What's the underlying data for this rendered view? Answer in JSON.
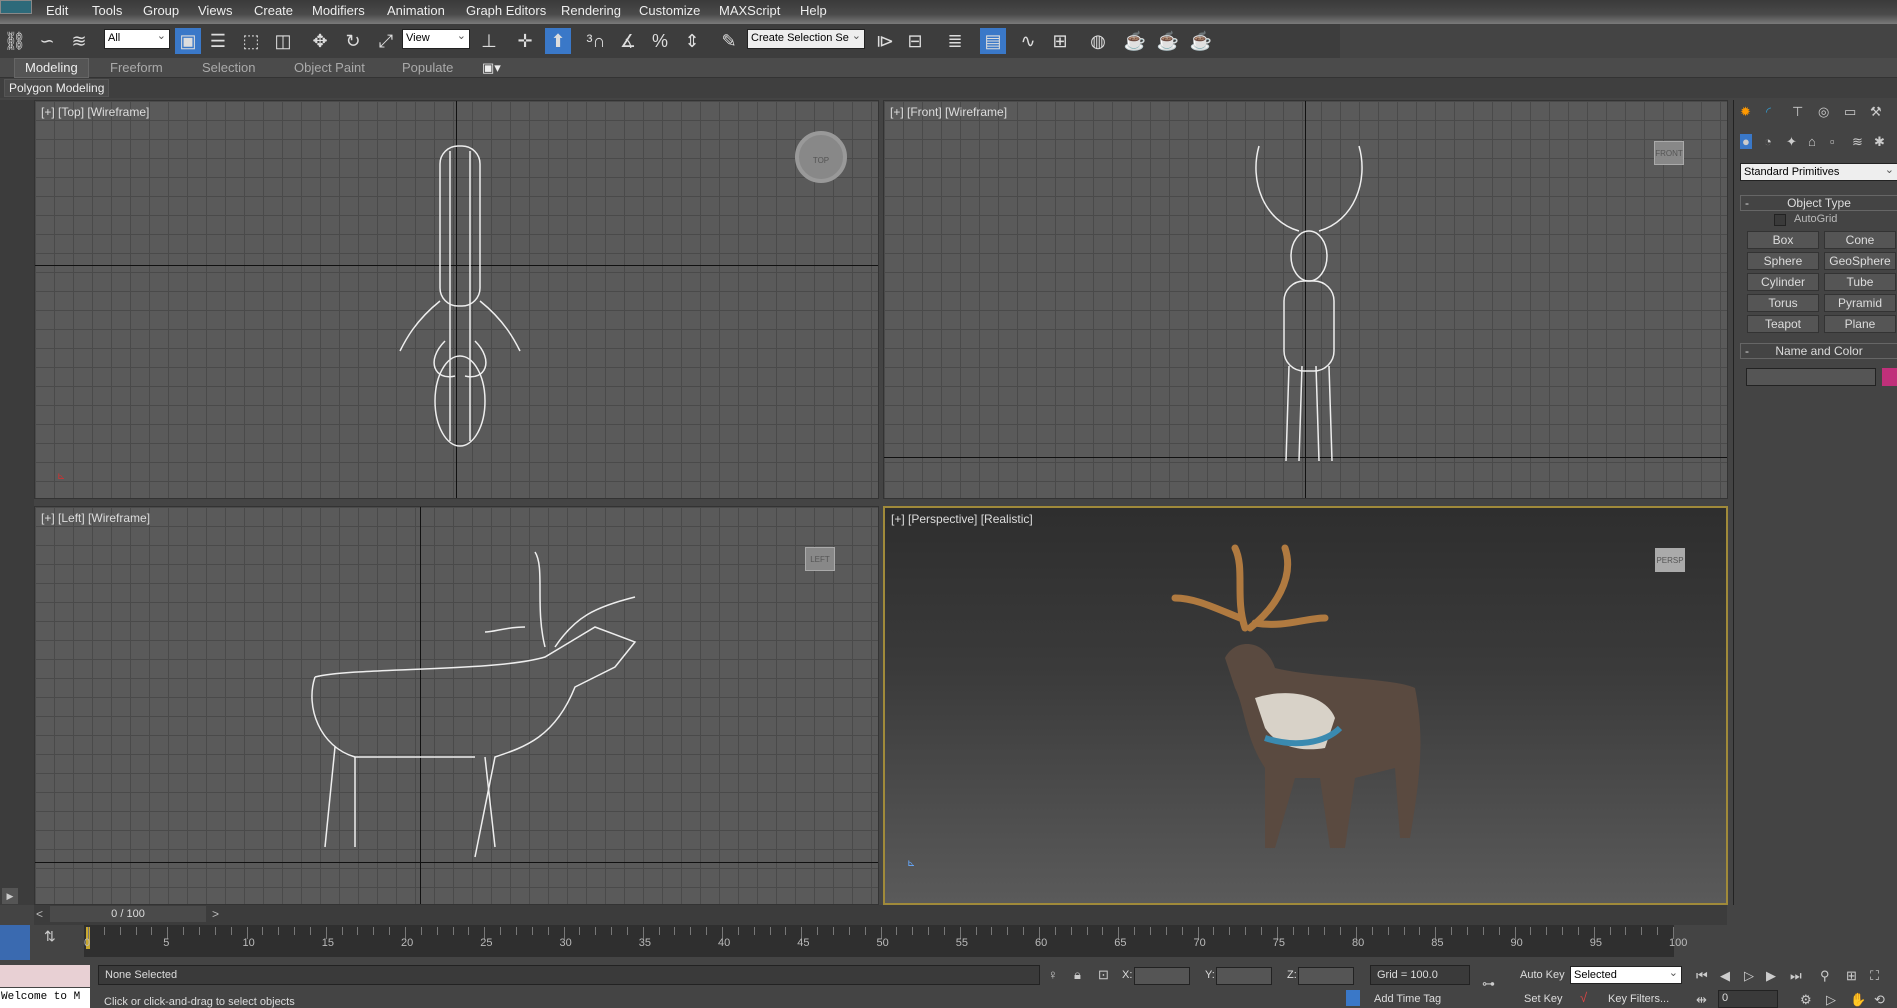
{
  "menu": [
    "Edit",
    "Tools",
    "Group",
    "Views",
    "Create",
    "Modifiers",
    "Animation",
    "Graph Editors",
    "Rendering",
    "Customize",
    "MAXScript",
    "Help"
  ],
  "toolbar": {
    "selection_filter": "All",
    "ref_coord": "View",
    "named_selection": "Create Selection Se"
  },
  "ribbon": {
    "tabs": [
      "Modeling",
      "Freeform",
      "Selection",
      "Object Paint",
      "Populate"
    ],
    "active": "Modeling",
    "subpanel": "Polygon Modeling"
  },
  "viewports": [
    {
      "label": "[+] [Top] [Wireframe]",
      "cube": "TOP"
    },
    {
      "label": "[+] [Front] [Wireframe]",
      "cube": "FRONT"
    },
    {
      "label": "[+] [Left] [Wireframe]",
      "cube": "LEFT"
    },
    {
      "label": "[+] [Perspective] [Realistic]",
      "cube": "PERSP"
    }
  ],
  "command_panel": {
    "category": "Standard Primitives",
    "object_type_title": "Object Type",
    "autogrid": "AutoGrid",
    "buttons": [
      "Box",
      "Cone",
      "Sphere",
      "GeoSphere",
      "Cylinder",
      "Tube",
      "Torus",
      "Pyramid",
      "Teapot",
      "Plane"
    ],
    "name_color_title": "Name and Color",
    "object_color": "#c0307a"
  },
  "timeline": {
    "frame_display": "0 / 100",
    "prev": "<",
    "next": ">",
    "current_frame": 0,
    "ticks": [
      "0",
      "5",
      "10",
      "15",
      "20",
      "25",
      "30",
      "35",
      "40",
      "45",
      "50",
      "55",
      "60",
      "65",
      "70",
      "75",
      "80",
      "85",
      "90",
      "95",
      "100"
    ]
  },
  "status": {
    "selection": "None Selected",
    "prompt": "Click or click-and-drag to select objects",
    "listener": "Welcome to M",
    "x_label": "X:",
    "y_label": "Y:",
    "z_label": "Z:",
    "grid": "Grid = 100.0",
    "add_time_tag": "Add Time Tag",
    "auto_key": "Auto Key",
    "set_key": "Set Key",
    "key_mode": "Selected",
    "key_filters": "Key Filters...",
    "frame": "0"
  }
}
